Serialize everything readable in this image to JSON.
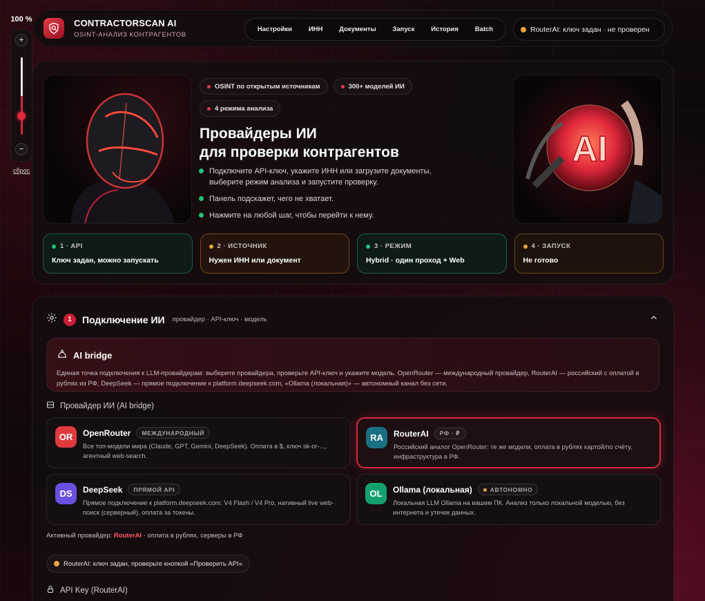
{
  "zoom": {
    "level": "100 %",
    "plus": "+",
    "minus": "−",
    "reset": "сброс",
    "value_fraction": 0.5
  },
  "header": {
    "title": "CONTRACTORSCAN AI",
    "subtitle": "OSINT-АНАЛИЗ КОНТРАГЕНТОВ",
    "nav": [
      "Настройки",
      "ИНН",
      "Документы",
      "Запуск",
      "История",
      "Batch"
    ],
    "status": "RouterAI: ключ задан · не проверен"
  },
  "hero": {
    "pills": [
      "OSINT по открытым источникам",
      "300+ моделей ИИ",
      "4 режима анализа"
    ],
    "title_line1": "Провайдеры ИИ",
    "title_line2": "для проверки контрагентов",
    "bullets": [
      "Подключите API-ключ, укажите ИНН или загрузите документы, выберите режим анализа и запустите проверку.",
      "Панель подскажет, чего не хватает.",
      "Нажмите на любой шаг, чтобы перейти к нему."
    ],
    "ai_text": "AI",
    "steps": [
      {
        "head": "1 · API",
        "value": "Ключ задан, можно запускать"
      },
      {
        "head": "2 · ИСТОЧНИК",
        "value": "Нужен ИНН или документ"
      },
      {
        "head": "3 · РЕЖИМ",
        "value": "Hybrid · один проход + Web"
      },
      {
        "head": "4 · ЗАПУСК",
        "value": "Не готово"
      }
    ]
  },
  "section": {
    "number": "1",
    "title": "Подключение ИИ",
    "subtitle": "провайдер · API-ключ · модель",
    "bridge": {
      "title": "AI bridge",
      "text": "Единая точка подключения к LLM-провайдерам: выберите провайдера, проверьте API-ключ и укажите модель. OpenRouter — международный провайдер, RouterAI — российский с оплатой в рублях из РФ, DeepSeek — прямое подключение к platform.deepseek.com, «Ollama (локальная)» — автономный канал без сети."
    },
    "provider_label": "Провайдер ИИ (AI bridge)",
    "providers": [
      {
        "initials": "OR",
        "name": "OpenRouter",
        "tag": "МЕЖДУНАРОДНЫЙ",
        "color": "#e03a3f",
        "desc": "Все топ-модели мира (Claude, GPT, Gemini, DeepSeek). Оплата в $, ключ sk-or-..., агентный web-search."
      },
      {
        "initials": "RA",
        "name": "RouterAI",
        "tag": "РФ · ₽",
        "color": "#1a6f82",
        "desc": "Российский аналог OpenRouter: те же модели, оплата в рублях картой/по счёту, инфраструктура в РФ."
      },
      {
        "initials": "DS",
        "name": "DeepSeek",
        "tag": "ПРЯМОЙ API",
        "color": "#6b4fe0",
        "desc": "Прямое подключение к platform.deepseek.com: V4 Flash / V4 Pro, нативный live web-поиск (серверный), оплата за токены."
      },
      {
        "initials": "OL",
        "name": "Ollama (локальная)",
        "tag": "АВТОНОМНО",
        "color": "#14a06c",
        "desc": "Локальная LLM Ollama на вашем ПК. Анализ только локальной моделью, без интернета и утечек данных."
      }
    ],
    "active_prefix": "Активный провайдер:",
    "active_name": "RouterAI",
    "active_suffix": "· оплата в рублях, серверы в РФ",
    "key_status": "RouterAI: ключ задан, проверьте кнопкой «Проверить API»",
    "api_key_label": "API Key (RouterAI)"
  }
}
